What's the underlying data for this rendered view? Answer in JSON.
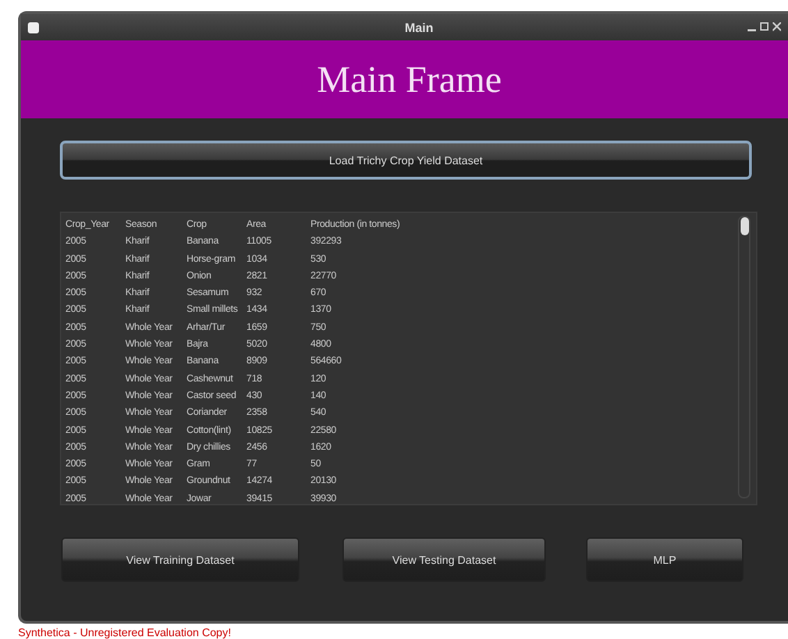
{
  "window": {
    "title": "Main"
  },
  "header": {
    "title": "Main Frame"
  },
  "load_button": "Load Trichy Crop Yield Dataset",
  "table": {
    "columns": [
      "Crop_Year",
      "Season",
      "Crop",
      "Area",
      "Production (in tonnes)"
    ],
    "rows": [
      [
        "2005",
        "Kharif",
        "Banana",
        "11005",
        "392293"
      ],
      [
        "2005",
        "Kharif",
        "Horse-gram",
        "1034",
        "530"
      ],
      [
        "2005",
        "Kharif",
        "Onion",
        "2821",
        "22770"
      ],
      [
        "2005",
        "Kharif",
        "Sesamum",
        "932",
        "670"
      ],
      [
        "2005",
        "Kharif",
        "Small millets",
        "1434",
        "1370"
      ],
      [
        "2005",
        "Whole Year",
        "Arhar/Tur",
        "1659",
        "750"
      ],
      [
        "2005",
        "Whole Year",
        "Bajra",
        "5020",
        "4800"
      ],
      [
        "2005",
        "Whole Year",
        "Banana",
        "8909",
        "564660"
      ],
      [
        "2005",
        "Whole Year",
        "Cashewnut",
        "718",
        "120"
      ],
      [
        "2005",
        "Whole Year",
        "Castor seed",
        "430",
        "140"
      ],
      [
        "2005",
        "Whole Year",
        "Coriander",
        "2358",
        "540"
      ],
      [
        "2005",
        "Whole Year",
        "Cotton(lint)",
        "10825",
        "22580"
      ],
      [
        "2005",
        "Whole Year",
        "Dry chillies",
        "2456",
        "1620"
      ],
      [
        "2005",
        "Whole Year",
        "Gram",
        "77",
        "50"
      ],
      [
        "2005",
        "Whole Year",
        "Groundnut",
        "14274",
        "20130"
      ],
      [
        "2005",
        "Whole Year",
        "Jowar",
        "39415",
        "39930"
      ]
    ]
  },
  "buttons": [
    "View Training Dataset",
    "View Testing Dataset",
    "MLP"
  ],
  "status_text": "Synthetica - Unregistered Evaluation Copy!"
}
